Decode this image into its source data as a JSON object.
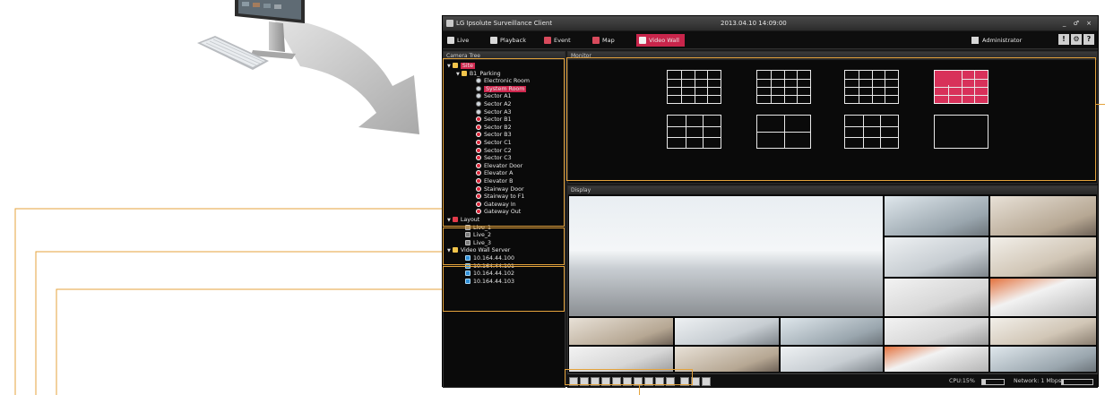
{
  "window": {
    "title": "LG Ipsolute Surveillance Client",
    "datetime": "2013.04.10 14:09:00",
    "controls": "_ ♂ ×"
  },
  "menu": {
    "tabs": [
      {
        "label": "Live"
      },
      {
        "label": "Playback"
      },
      {
        "label": "Event"
      },
      {
        "label": "Map"
      },
      {
        "label": "Video Wall"
      }
    ],
    "user": "Administrator",
    "buttons": [
      "!",
      "⚙",
      "?"
    ]
  },
  "camera_tree": {
    "title": "Camera Tree",
    "site": "Site",
    "group": "B1_Parking",
    "cameras": [
      "Electronic Room",
      "System Room",
      "Sector A1",
      "Sector A2",
      "Sector A3",
      "Sector B1",
      "Sector B2",
      "Sector B3",
      "Sector C1",
      "Sector C2",
      "Sector C3",
      "Elevator Door",
      "Elevator A",
      "Elevator B",
      "Stairway Door",
      "Stairway to F1",
      "Gateway In",
      "Gateway Out"
    ],
    "selected_camera": "System Room",
    "layout_folder": "Layout",
    "layouts": [
      "Live_1",
      "Live_2",
      "Live_3"
    ],
    "server_folder": "Video Wall Server",
    "servers": [
      "10.164.44.100",
      "10.164.44.101",
      "10.164.44.102",
      "10.164.44.103"
    ]
  },
  "monitor": {
    "title": "Monitor",
    "layouts": [
      {
        "grid": "4x4"
      },
      {
        "grid": "4x4"
      },
      {
        "grid": "4x4"
      },
      {
        "grid": "custom",
        "selected": true
      },
      {
        "grid": "3x3"
      },
      {
        "grid": "2x2"
      },
      {
        "grid": "3x3"
      },
      {
        "grid": "1x1"
      }
    ]
  },
  "display": {
    "title": "Display",
    "main_view": "office-panorama",
    "thumbnails": 12
  },
  "status": {
    "cpu_label": "CPU:15%",
    "cpu_value": 0.15,
    "network_label": "Network: 1 Mbps",
    "network_value": 0.05
  },
  "colors": {
    "accent": "#c8254b",
    "callout": "#e4a33c",
    "arrow": "#b9b9b9"
  }
}
